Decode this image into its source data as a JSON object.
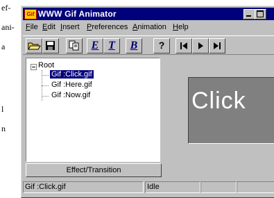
{
  "window": {
    "title": "WWW Gif Animator",
    "app_icon_text": "Gif"
  },
  "menu": {
    "items": [
      {
        "label": "ile",
        "accel": "F"
      },
      {
        "label": "dit",
        "accel": "E"
      },
      {
        "label": "nsert",
        "accel": "I"
      },
      {
        "label": "references",
        "accel": "P"
      },
      {
        "label": "nimation",
        "accel": "A"
      },
      {
        "label": "elp",
        "accel": "H"
      }
    ]
  },
  "toolbar": {
    "tools": [
      {
        "icon": "open-folder-icon"
      },
      {
        "icon": "save-disk-icon"
      },
      {
        "icon": "copy-icon"
      },
      {
        "icon": "letter-e-icon",
        "text": "E"
      },
      {
        "icon": "letter-t-icon",
        "text": "T"
      },
      {
        "icon": "letter-b-icon",
        "text": "B"
      },
      {
        "icon": "help-icon",
        "text": "?"
      },
      {
        "icon": "first-frame-icon"
      },
      {
        "icon": "play-icon"
      },
      {
        "icon": "last-frame-icon"
      }
    ]
  },
  "tree": {
    "root": "Root",
    "items": [
      "Gif :Click.gif",
      "Gif :Here.gif",
      "Gif :Now.gif"
    ],
    "selected_index": 0
  },
  "effect_button": "Effect/Transition",
  "preview": {
    "text": "Click"
  },
  "status": {
    "file": "Gif :Click.gif",
    "state": "Idle"
  },
  "page_fragment": {
    "lines": [
      "ef-",
      "ani-",
      "a",
      "",
      "",
      "l",
      "n"
    ]
  }
}
